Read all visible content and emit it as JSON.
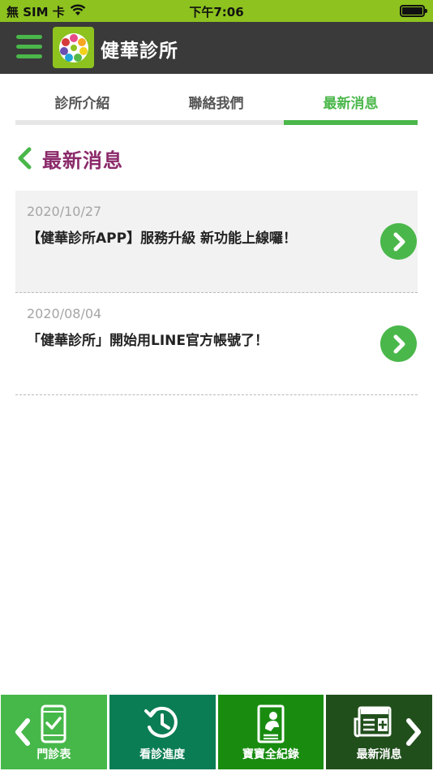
{
  "status_bar": {
    "carrier": "無 SIM 卡",
    "time": "下午7:06"
  },
  "header": {
    "title": "健華診所"
  },
  "tabs": [
    {
      "label": "診所介紹",
      "active": false
    },
    {
      "label": "聯絡我們",
      "active": false
    },
    {
      "label": "最新消息",
      "active": true
    }
  ],
  "section": {
    "title": "最新消息"
  },
  "news": [
    {
      "date": "2020/10/27",
      "title": "【健華診所APP】服務升級 新功能上線囉！"
    },
    {
      "date": "2020/08/04",
      "title": "「健華診所」開始用LINE官方帳號了！"
    }
  ],
  "bottom_nav": [
    {
      "label": "門診表",
      "icon": "phone-check-icon"
    },
    {
      "label": "看診進度",
      "icon": "clock-history-icon"
    },
    {
      "label": "寶寶全紀錄",
      "icon": "baby-record-icon"
    },
    {
      "label": "最新消息",
      "icon": "newspaper-icon"
    }
  ],
  "colors": {
    "status_bar": "#8dc21f",
    "header_bg": "#3a3a3a",
    "accent_green": "#4ab74a",
    "section_title": "#8b2a6a"
  }
}
